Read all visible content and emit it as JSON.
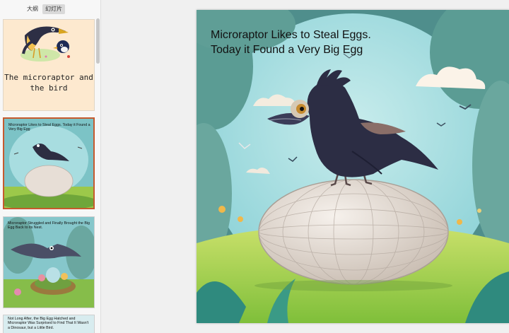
{
  "tabs": [
    {
      "label": "大纲",
      "active": false
    },
    {
      "label": "幻灯片",
      "active": true
    }
  ],
  "thumbnails": [
    {
      "index": 1,
      "title": "The microraptor and the bird"
    },
    {
      "index": 2,
      "caption": "Microraptor Likes to Steal Eggs. Today it Found a Very Big Egg",
      "selected": true
    },
    {
      "index": 3,
      "caption": "Microraptor Struggled and Finally Brought the Big Egg Back to its Nest."
    },
    {
      "index": 4,
      "caption": "Not Long After, the Big Egg Hatched and Microraptor Was Surprised to Find That It Wasn't a Dinosaur, but a Little Bird."
    }
  ],
  "slide": {
    "title": "Microraptor Likes to Steal Eggs.\n Today it Found a Very Big Egg"
  },
  "colors": {
    "selected_border": "#c65a2e",
    "sky": "#8fd3d8",
    "grass": "#9ccf4a",
    "egg": "#ece4dc"
  }
}
